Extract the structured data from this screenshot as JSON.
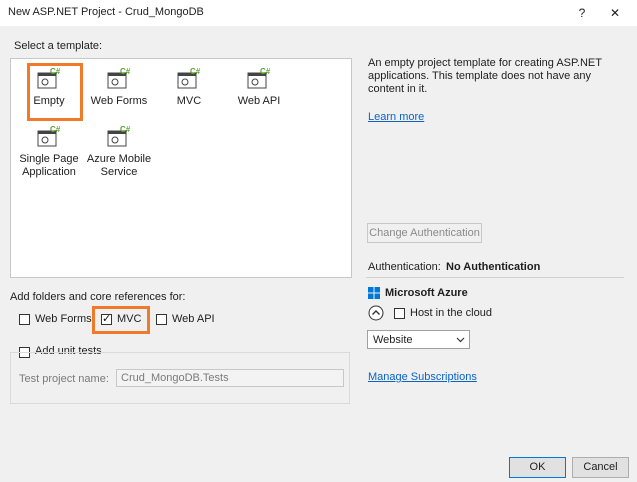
{
  "window": {
    "title": "New ASP.NET Project - Crud_MongoDB",
    "help": "?",
    "close": "✕"
  },
  "templates": {
    "heading": "Select a template:",
    "items": [
      {
        "label": "Empty"
      },
      {
        "label": "Web Forms"
      },
      {
        "label": "MVC"
      },
      {
        "label": "Web API"
      },
      {
        "label": "Single Page Application"
      },
      {
        "label": "Azure Mobile Service"
      }
    ]
  },
  "description": {
    "text": "An empty project template for creating ASP.NET applications. This template does not have any content in it.",
    "learn_more": "Learn more"
  },
  "auth": {
    "change_button": "Change Authentication",
    "label": "Authentication:",
    "value": "No Authentication"
  },
  "folders": {
    "heading": "Add folders and core references for:",
    "web_forms": "Web Forms",
    "mvc": "MVC",
    "web_api": "Web API",
    "mvc_checked": true
  },
  "unit_tests": {
    "label": "Add unit tests",
    "project_name_label": "Test project name:",
    "project_name_value": "Crud_MongoDB.Tests"
  },
  "azure": {
    "title": "Microsoft Azure",
    "host_label": "Host in the cloud",
    "select_value": "Website",
    "manage": "Manage Subscriptions"
  },
  "footer": {
    "ok": "OK",
    "cancel": "Cancel"
  },
  "colors": {
    "highlight": "#f07a2a",
    "link": "#0c63c4"
  }
}
